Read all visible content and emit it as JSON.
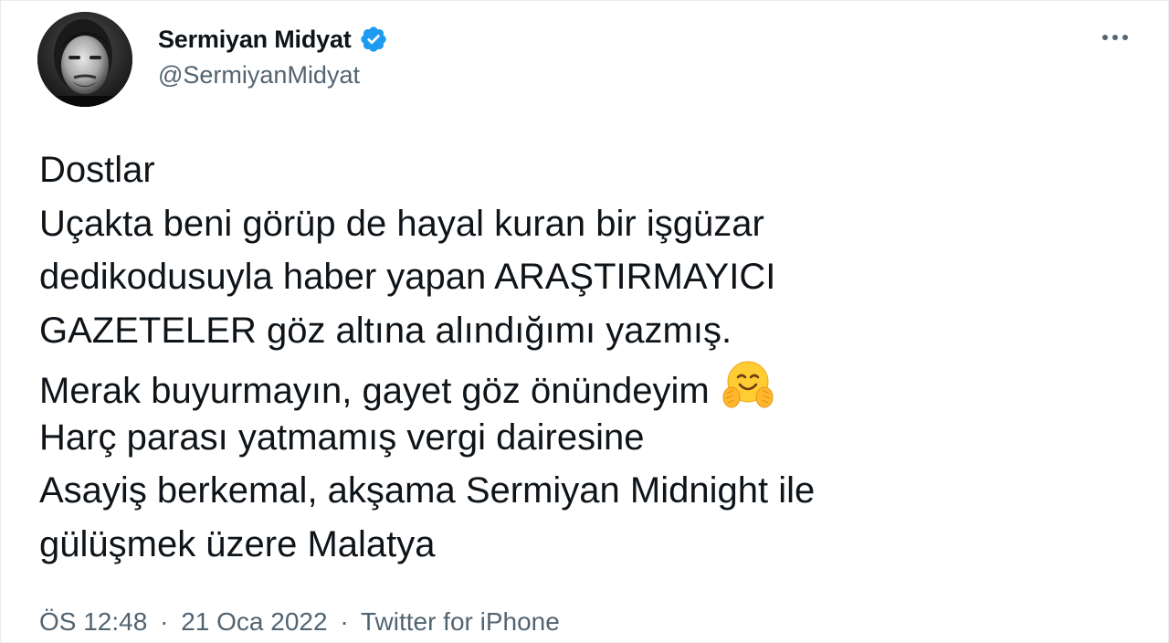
{
  "author": {
    "display_name": "Sermiyan Midyat",
    "handle": "@SermiyanMidyat",
    "verified": true
  },
  "tweet": {
    "lines": [
      "Dostlar",
      "Uçakta beni görüp de hayal kuran bir işgüzar",
      "dedikodusuyla haber yapan ARAŞTIRMAYICI",
      "GAZETELER göz altına alındığımı yazmış.",
      "Merak buyurmayın, gayet göz önündeyim",
      "Harç parası yatmamış vergi dairesine",
      "Asayiş berkemal, akşama Sermiyan Midnight ile",
      "gülüşmek üzere Malatya"
    ],
    "emoji": "hugging-face"
  },
  "meta": {
    "time": "ÖS 12:48",
    "date": "21 Oca 2022",
    "separator": "·",
    "source": "Twitter for iPhone"
  },
  "icons": {
    "verified": "verified-badge-icon",
    "more": "more-options-icon"
  },
  "colors": {
    "verified": "#1d9bf0",
    "text": "#0f1419",
    "secondary": "#536471"
  }
}
